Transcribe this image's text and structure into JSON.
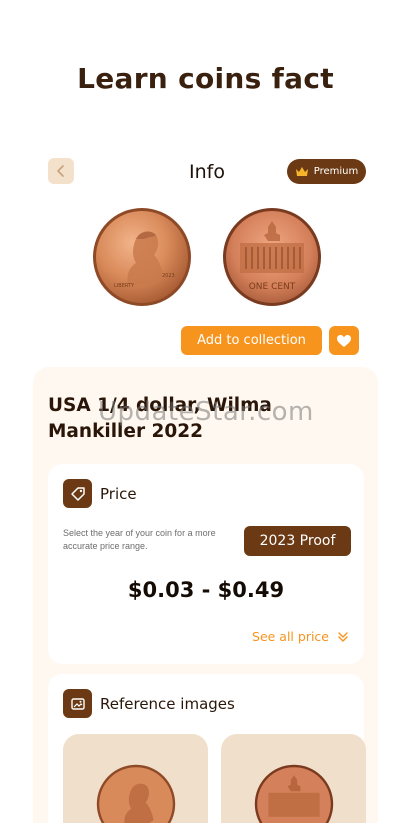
{
  "headline": "Learn coins fact",
  "topbar": {
    "back_icon": "chevron-left-icon",
    "title": "Info",
    "premium_label": "Premium",
    "premium_icon": "crown-icon"
  },
  "coin": {
    "front_inscription": "LIBERTY",
    "front_year": "2023",
    "back_inscription": "ONE CENT",
    "name": "USA 1/4 dollar, Wilma Mankiller 2022"
  },
  "actions": {
    "add_label": "Add to collection",
    "favorite_icon": "heart-icon"
  },
  "watermark": "UpdateStar.com",
  "price": {
    "title": "Price",
    "icon": "price-tag-icon",
    "hint": "Select the year of your coin for a more accurate price range.",
    "year_button": "2023 Proof",
    "range": "$0.03 - $0.49",
    "see_all": "See all price"
  },
  "references": {
    "title": "Reference images",
    "icon": "image-icon"
  },
  "colors": {
    "accent_orange": "#f7941d",
    "brand_brown": "#6b3a14",
    "panel_bg": "#fff8f0"
  }
}
